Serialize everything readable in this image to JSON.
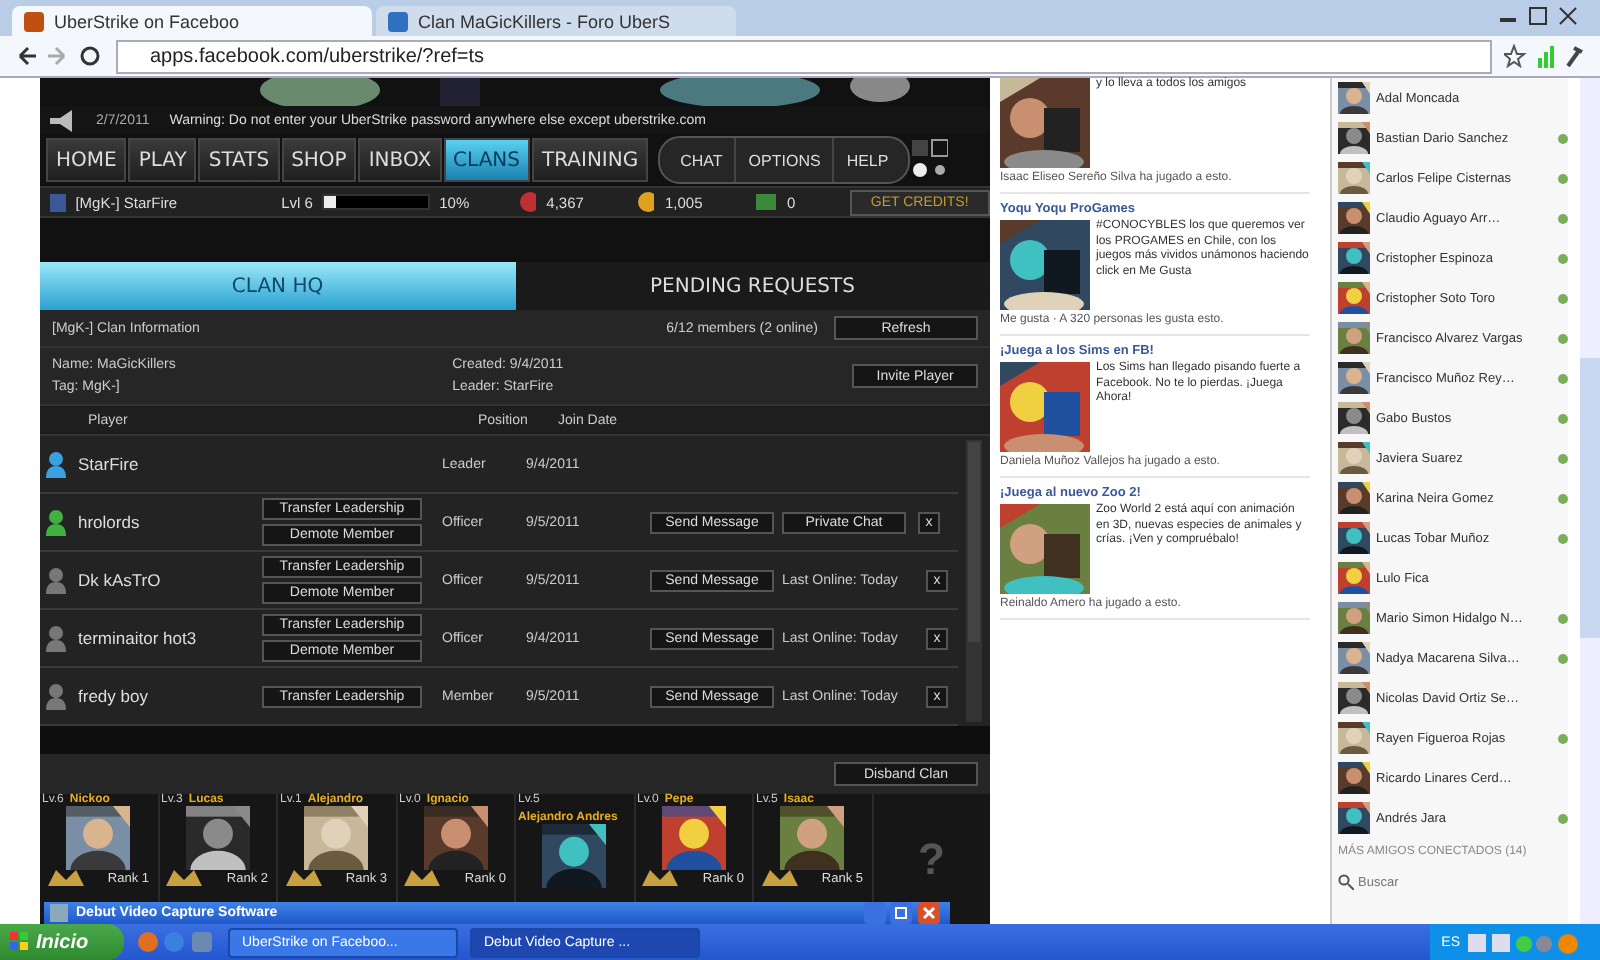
{
  "browser": {
    "tabs": [
      {
        "title": "UberStrike on Faceboo",
        "selected": true
      },
      {
        "title": "Clan MaGicKillers - Foro UberS",
        "selected": false
      }
    ],
    "address": "apps.facebook.com/uberstrike/?ref=ts"
  },
  "game": {
    "warning_date": "2/7/2011",
    "warning": "Warning: Do not enter your UberStrike password anywhere else except uberstrike.com",
    "nav": [
      {
        "label": "HOME",
        "selected": false
      },
      {
        "label": "PLAY",
        "selected": false
      },
      {
        "label": "STATS",
        "selected": false
      },
      {
        "label": "SHOP",
        "selected": false
      },
      {
        "label": "INBOX",
        "selected": false
      },
      {
        "label": "CLANS",
        "selected": true
      },
      {
        "label": "TRAINING",
        "selected": false
      }
    ],
    "nav_right": [
      "CHAT",
      "OPTIONS",
      "HELP"
    ],
    "player": "[MgK-] StarFire",
    "level_label": "Lvl 6",
    "xp": {
      "level": 0.1
    },
    "xp_reading": "10%",
    "points": "4,367",
    "credits": "1,005",
    "cash": "0",
    "get_credits": "GET CREDITS!",
    "tabs": [
      {
        "label": "CLAN HQ",
        "selected": true
      },
      {
        "label": "PENDING REQUESTS",
        "selected": false
      }
    ],
    "clan_info": "[MgK-] Clan Information",
    "members_count": "6/12 members (2 online)",
    "refresh": "Refresh",
    "name": "Name: MaGicKillers",
    "tag": "Tag: MgK-]",
    "created": "Created: 9/4/2011",
    "leader": "Leader: StarFire",
    "invite": "Invite Player",
    "columns": [
      "Player",
      "Position",
      "Join Date"
    ],
    "rows": [
      {
        "kind": "self",
        "name": "StarFire",
        "position": "Leader",
        "joined": "9/4/2011",
        "actions": []
      },
      {
        "kind": "online",
        "name": "hrolords",
        "position": "Officer",
        "joined": "9/5/2011",
        "actions": [
          "Transfer Leadership",
          "Demote Member"
        ],
        "message": "Send Message",
        "extra": {
          "kind": "button",
          "label": "Private Chat"
        },
        "remove": "x"
      },
      {
        "kind": "offline",
        "name": "Dk kAsTrO",
        "position": "Officer",
        "joined": "9/5/2011",
        "actions": [
          "Transfer Leadership",
          "Demote Member"
        ],
        "message": "Send Message",
        "extra": {
          "kind": "text",
          "label": "Last Online: Today"
        },
        "remove": "x"
      },
      {
        "kind": "offline",
        "name": "terminaitor hot3",
        "position": "Officer",
        "joined": "9/4/2011",
        "actions": [
          "Transfer Leadership",
          "Demote Member"
        ],
        "message": "Send Message",
        "extra": {
          "kind": "text",
          "label": "Last Online: Today"
        },
        "remove": "x"
      },
      {
        "kind": "offline",
        "name": "fredy boy",
        "position": "Member",
        "joined": "9/5/2011",
        "actions": [
          "Transfer Leadership"
        ],
        "message": "Send Message",
        "extra": {
          "kind": "text",
          "label": "Last Online: Today"
        },
        "remove": "x"
      }
    ],
    "disband": "Disband Clan",
    "friends": [
      {
        "level": "Lv.6",
        "name": "Nickoo",
        "rank": "Rank 1"
      },
      {
        "level": "Lv.3",
        "name": "Lucas",
        "rank": "Rank 2"
      },
      {
        "level": "Lv.1",
        "name": "Alejandro",
        "rank": "Rank 3"
      },
      {
        "level": "Lv.0",
        "name": "Ignacio",
        "rank": "Rank 0"
      },
      {
        "level": "Lv.5",
        "name": "Alejandro Andres"
      },
      {
        "level": "Lv.0",
        "name": "Pepe",
        "rank": "Rank 0"
      },
      {
        "level": "Lv.5",
        "name": "Isaac",
        "rank": "Rank 5"
      }
    ],
    "unknown_slot": "?"
  },
  "overlay_window": {
    "title": "Debut Video Capture Software"
  },
  "ads": [
    {
      "text": "y lo lleva a todos los amigos",
      "footer": "Isaac Eliseo Sereño Silva ha jugado a esto."
    },
    {
      "title": "Yoqu Yoqu ProGames",
      "text": "#CONOCYBLES los que queremos ver los PROGAMES en Chile, con los juegos más vividos unámonos haciendo click en Me Gusta",
      "footer": "Me gusta · A 320 personas les gusta esto."
    },
    {
      "title": "¡Juega a los Sims en FB!",
      "text": "Los Sims han llegado pisando fuerte a Facebook. No te lo pierdas. ¡Juega Ahora!",
      "footer": "Daniela Muñoz Vallejos ha jugado a esto."
    },
    {
      "title": "¡Juega al nuevo Zoo 2!",
      "text": "Zoo World 2 está aquí con animación en 3D, nuevas especies de animales y crías. ¡Ven y compruébalo!",
      "footer": "Reinaldo Amero ha jugado a esto."
    }
  ],
  "chat": {
    "friends": [
      {
        "name": "Adal Moncada",
        "online": false
      },
      {
        "name": "Bastian Dario Sanchez",
        "online": true
      },
      {
        "name": "Carlos Felipe Cisternas",
        "online": true
      },
      {
        "name": "Claudio Aguayo Arr…",
        "online": true
      },
      {
        "name": "Cristopher Espinoza",
        "online": true
      },
      {
        "name": "Cristopher Soto Toro",
        "online": true
      },
      {
        "name": "Francisco Alvarez Vargas",
        "online": true
      },
      {
        "name": "Francisco Muñoz Rey…",
        "online": true
      },
      {
        "name": "Gabo Bustos",
        "online": true
      },
      {
        "name": "Javiera Suarez",
        "online": true
      },
      {
        "name": "Karina Neira Gomez",
        "online": true
      },
      {
        "name": "Lucas Tobar Muñoz",
        "online": true
      },
      {
        "name": "Lulo Fica",
        "online": false
      },
      {
        "name": "Mario Simon Hidalgo N…",
        "online": true
      },
      {
        "name": "Nadya Macarena Silva…",
        "online": true
      },
      {
        "name": "Nicolas David Ortiz Se…",
        "online": false
      },
      {
        "name": "Rayen Figueroa Rojas",
        "online": true
      },
      {
        "name": "Ricardo Linares Cerd…",
        "online": false
      },
      {
        "name": "Andrés Jara",
        "online": true
      }
    ],
    "more": "MÁS AMIGOS CONECTADOS (14)",
    "search_placeholder": "Buscar"
  },
  "taskbar": {
    "start": "Inicio",
    "windows": [
      {
        "title": "UberStrike on Faceboo...",
        "selected": false
      },
      {
        "title": "Debut Video Capture ...",
        "selected": true
      }
    ],
    "language": "ES"
  }
}
